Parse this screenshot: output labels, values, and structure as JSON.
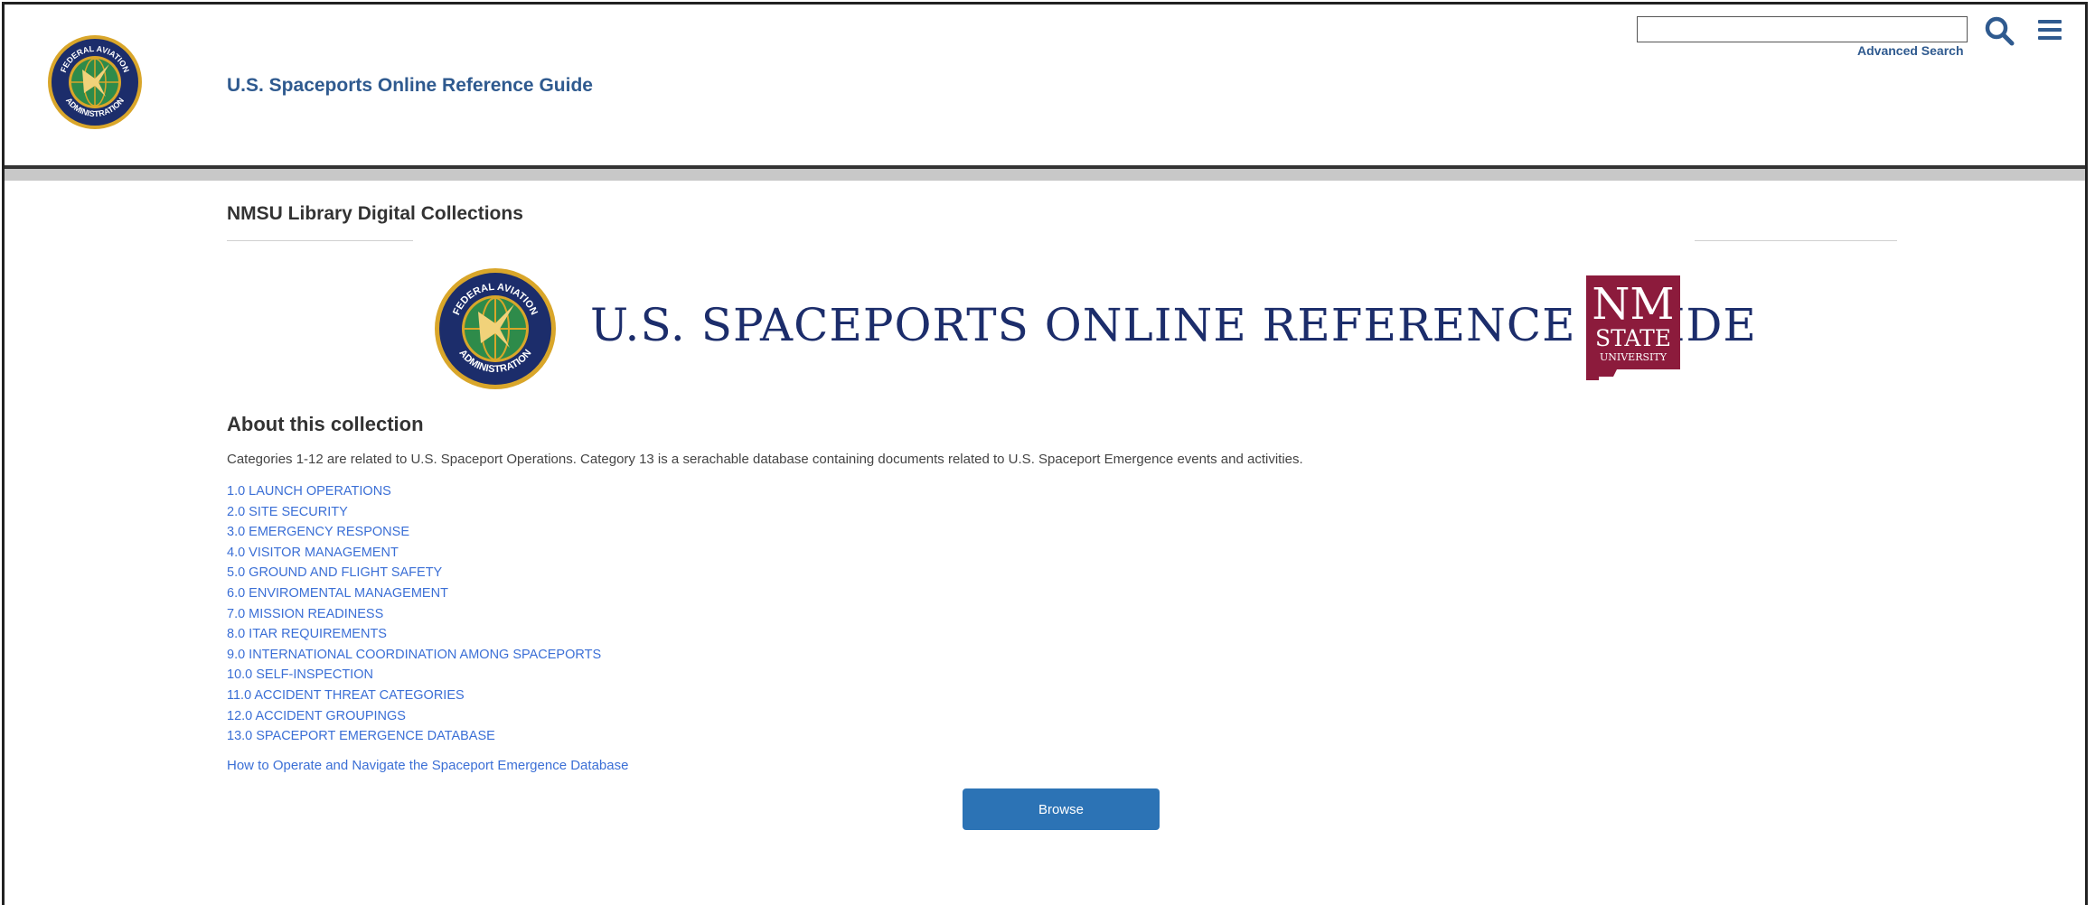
{
  "header": {
    "site_title": "U.S. Spaceports Online Reference Guide",
    "seal_text_top": "FEDERAL AVIATION",
    "seal_text_bottom": "ADMINISTRATION",
    "search": {
      "value": "",
      "placeholder": "",
      "advanced_label": "Advanced Search"
    },
    "icons": {
      "search": "search-icon",
      "menu": "hamburger-menu-icon"
    }
  },
  "content": {
    "collection_title": "NMSU Library Digital Collections",
    "banner": {
      "title": "U.S. SPACEPORTS ONLINE REFERENCE GUIDE",
      "seal_text_top": "FEDERAL AVIATION",
      "seal_text_bottom": "ADMINISTRATION",
      "nmsu_line1": "NM",
      "nmsu_line2": "STATE",
      "nmsu_line3": "UNIVERSITY"
    },
    "about_heading": "About this collection",
    "about_description": "Categories 1-12 are related to U.S. Spaceport Operations. Category 13 is a serachable database containing documents related to U.S. Spaceport Emergence events and activities.",
    "categories": [
      "1.0 LAUNCH OPERATIONS",
      "2.0 SITE SECURITY",
      "3.0 EMERGENCY RESPONSE",
      "4.0 VISITOR MANAGEMENT",
      "5.0 GROUND AND FLIGHT SAFETY",
      "6.0 ENVIROMENTAL MANAGEMENT",
      "7.0 MISSION READINESS",
      "8.0 ITAR REQUIREMENTS",
      "9.0 INTERNATIONAL COORDINATION AMONG SPACEPORTS",
      "10.0 SELF-INSPECTION",
      "11.0 ACCIDENT THREAT CATEGORIES",
      "12.0 ACCIDENT GROUPINGS",
      "13.0 SPACEPORT EMERGENCE DATABASE"
    ],
    "howto_link": "How to Operate and Navigate the Spaceport Emergence Database",
    "browse_button": "Browse"
  },
  "colors": {
    "brand_blue": "#2f5a8f",
    "link_blue": "#3b6fd6",
    "button_blue": "#2c73b5",
    "nmsu_crimson": "#8c1b3c",
    "faa_navy": "#1c2d6b"
  }
}
